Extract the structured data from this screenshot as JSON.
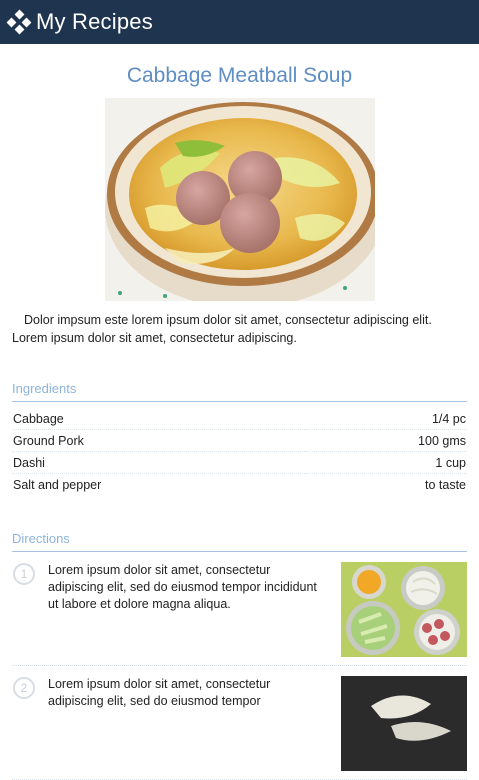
{
  "header": {
    "title": "My Recipes",
    "logo_icon": "diamond-logo-icon"
  },
  "recipe": {
    "title": "Cabbage Meatball Soup",
    "description": "Dolor impsum este lorem ipsum dolor sit amet, consectetur adipiscing elit. Lorem ipsum dolor sit amet, consectetur adipiscing."
  },
  "ingredients": {
    "heading": "Ingredients",
    "items": [
      {
        "name": "Cabbage",
        "qty": "1/4 pc"
      },
      {
        "name": "Ground Pork",
        "qty": "100 gms"
      },
      {
        "name": "Dashi",
        "qty": "1 cup"
      },
      {
        "name": "Salt and pepper",
        "qty": "to taste"
      }
    ]
  },
  "directions": {
    "heading": "Directions",
    "steps": [
      {
        "number": "1",
        "text": "Lorem ipsum dolor sit amet, consectetur adipiscing elit, sed do eiusmod tempor incididunt ut labore et dolore magna aliqua."
      },
      {
        "number": "2",
        "text": "Lorem ipsum dolor sit amet, consectetur adipiscing elit, sed do eiusmod tempor"
      }
    ]
  },
  "colors": {
    "header_bg": "#1e344f",
    "title": "#5e8ec3",
    "section_heading": "#8db3dc"
  }
}
